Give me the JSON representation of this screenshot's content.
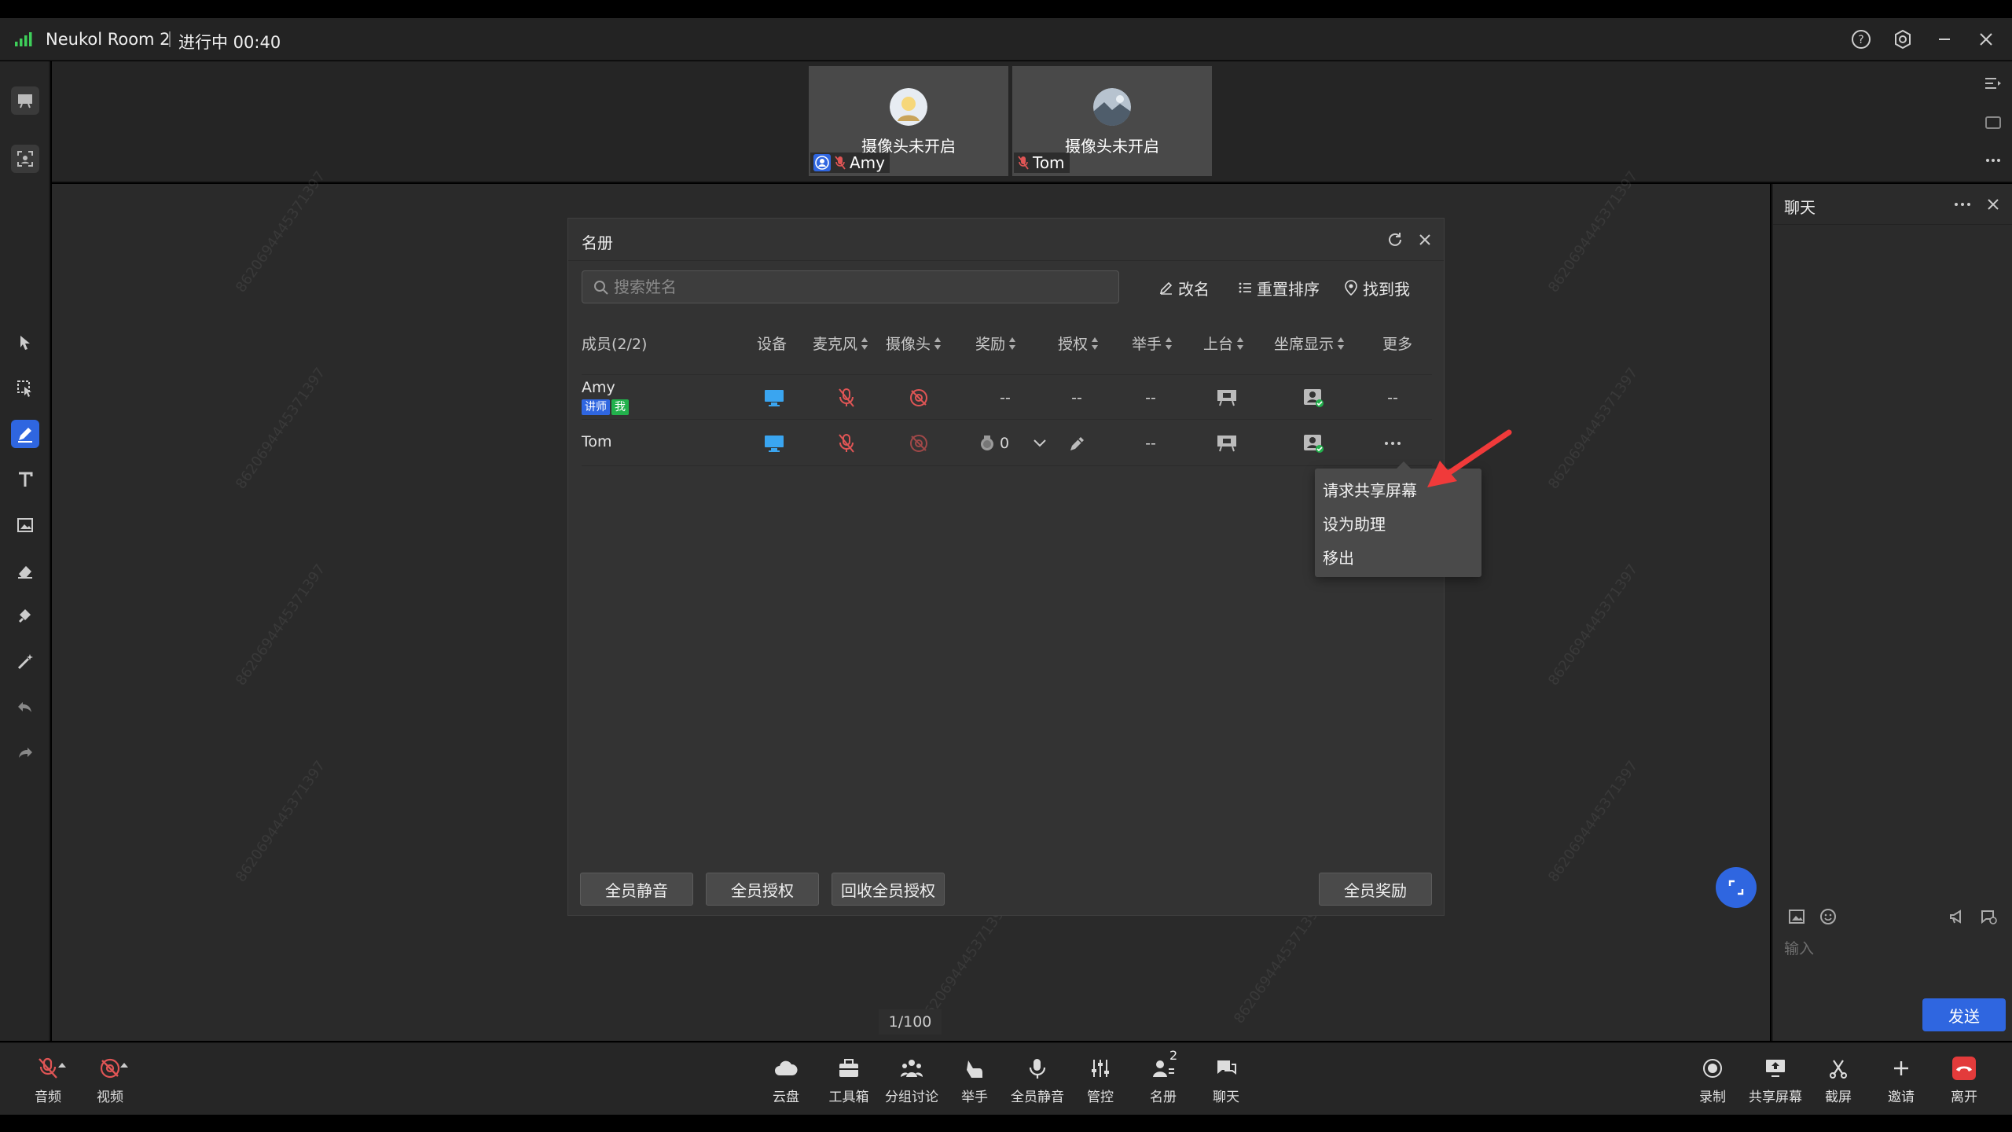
{
  "titlebar": {
    "room_name": "Neukol Room 2",
    "status": "进行中 00:40"
  },
  "videos": [
    {
      "camera_status": "摄像头未开启",
      "name": "Amy"
    },
    {
      "camera_status": "摄像头未开启",
      "name": "Tom"
    }
  ],
  "roster": {
    "title": "名册",
    "search_placeholder": "搜索姓名",
    "rename_label": "改名",
    "reorder_label": "重置排序",
    "findme_label": "找到我",
    "columns": {
      "members": "成员(2/2)",
      "device": "设备",
      "mic": "麦克风",
      "camera": "摄像头",
      "reward": "奖励",
      "auth": "授权",
      "raise": "举手",
      "stage": "上台",
      "seat": "坐席显示",
      "more": "更多"
    },
    "rows": [
      {
        "name": "Amy",
        "badge_role": "讲师",
        "badge_me": "我",
        "reward": "--",
        "auth": "--",
        "raise": "--",
        "more": "--"
      },
      {
        "name": "Tom",
        "reward": "0",
        "raise": "--"
      }
    ],
    "footer": {
      "mute_all": "全员静音",
      "auth_all": "全员授权",
      "revoke_all": "回收全员授权",
      "reward_all": "全员奖励"
    }
  },
  "context_menu": {
    "items": [
      "请求共享屏幕",
      "设为助理",
      "移出"
    ]
  },
  "chat": {
    "title": "聊天",
    "input_placeholder": "输入",
    "send_label": "发送"
  },
  "pager": "1/100",
  "bottombar": {
    "left": [
      {
        "label": "音频",
        "icon": "mic-off-icon"
      },
      {
        "label": "视频",
        "icon": "camera-off-icon"
      }
    ],
    "center": [
      {
        "label": "云盘",
        "icon": "cloud-icon"
      },
      {
        "label": "工具箱",
        "icon": "toolbox-icon"
      },
      {
        "label": "分组讨论",
        "icon": "group-icon"
      },
      {
        "label": "举手",
        "icon": "hand-icon"
      },
      {
        "label": "全员静音",
        "icon": "mute-all-icon"
      },
      {
        "label": "管控",
        "icon": "controls-icon"
      },
      {
        "label": "名册",
        "icon": "roster-icon",
        "badge": "2"
      },
      {
        "label": "聊天",
        "icon": "chat-icon"
      }
    ],
    "right": [
      {
        "label": "录制",
        "icon": "record-icon"
      },
      {
        "label": "共享屏幕",
        "icon": "share-screen-icon"
      },
      {
        "label": "截屏",
        "icon": "screenshot-icon"
      },
      {
        "label": "邀请",
        "icon": "invite-icon"
      },
      {
        "label": "离开",
        "icon": "leave-icon"
      }
    ]
  },
  "colors": {
    "accent": "#2f66e0",
    "leave": "#e33b3b",
    "mic_off": "#e05555",
    "badge_teacher": "#2f66e0",
    "badge_me": "#22b14c"
  }
}
